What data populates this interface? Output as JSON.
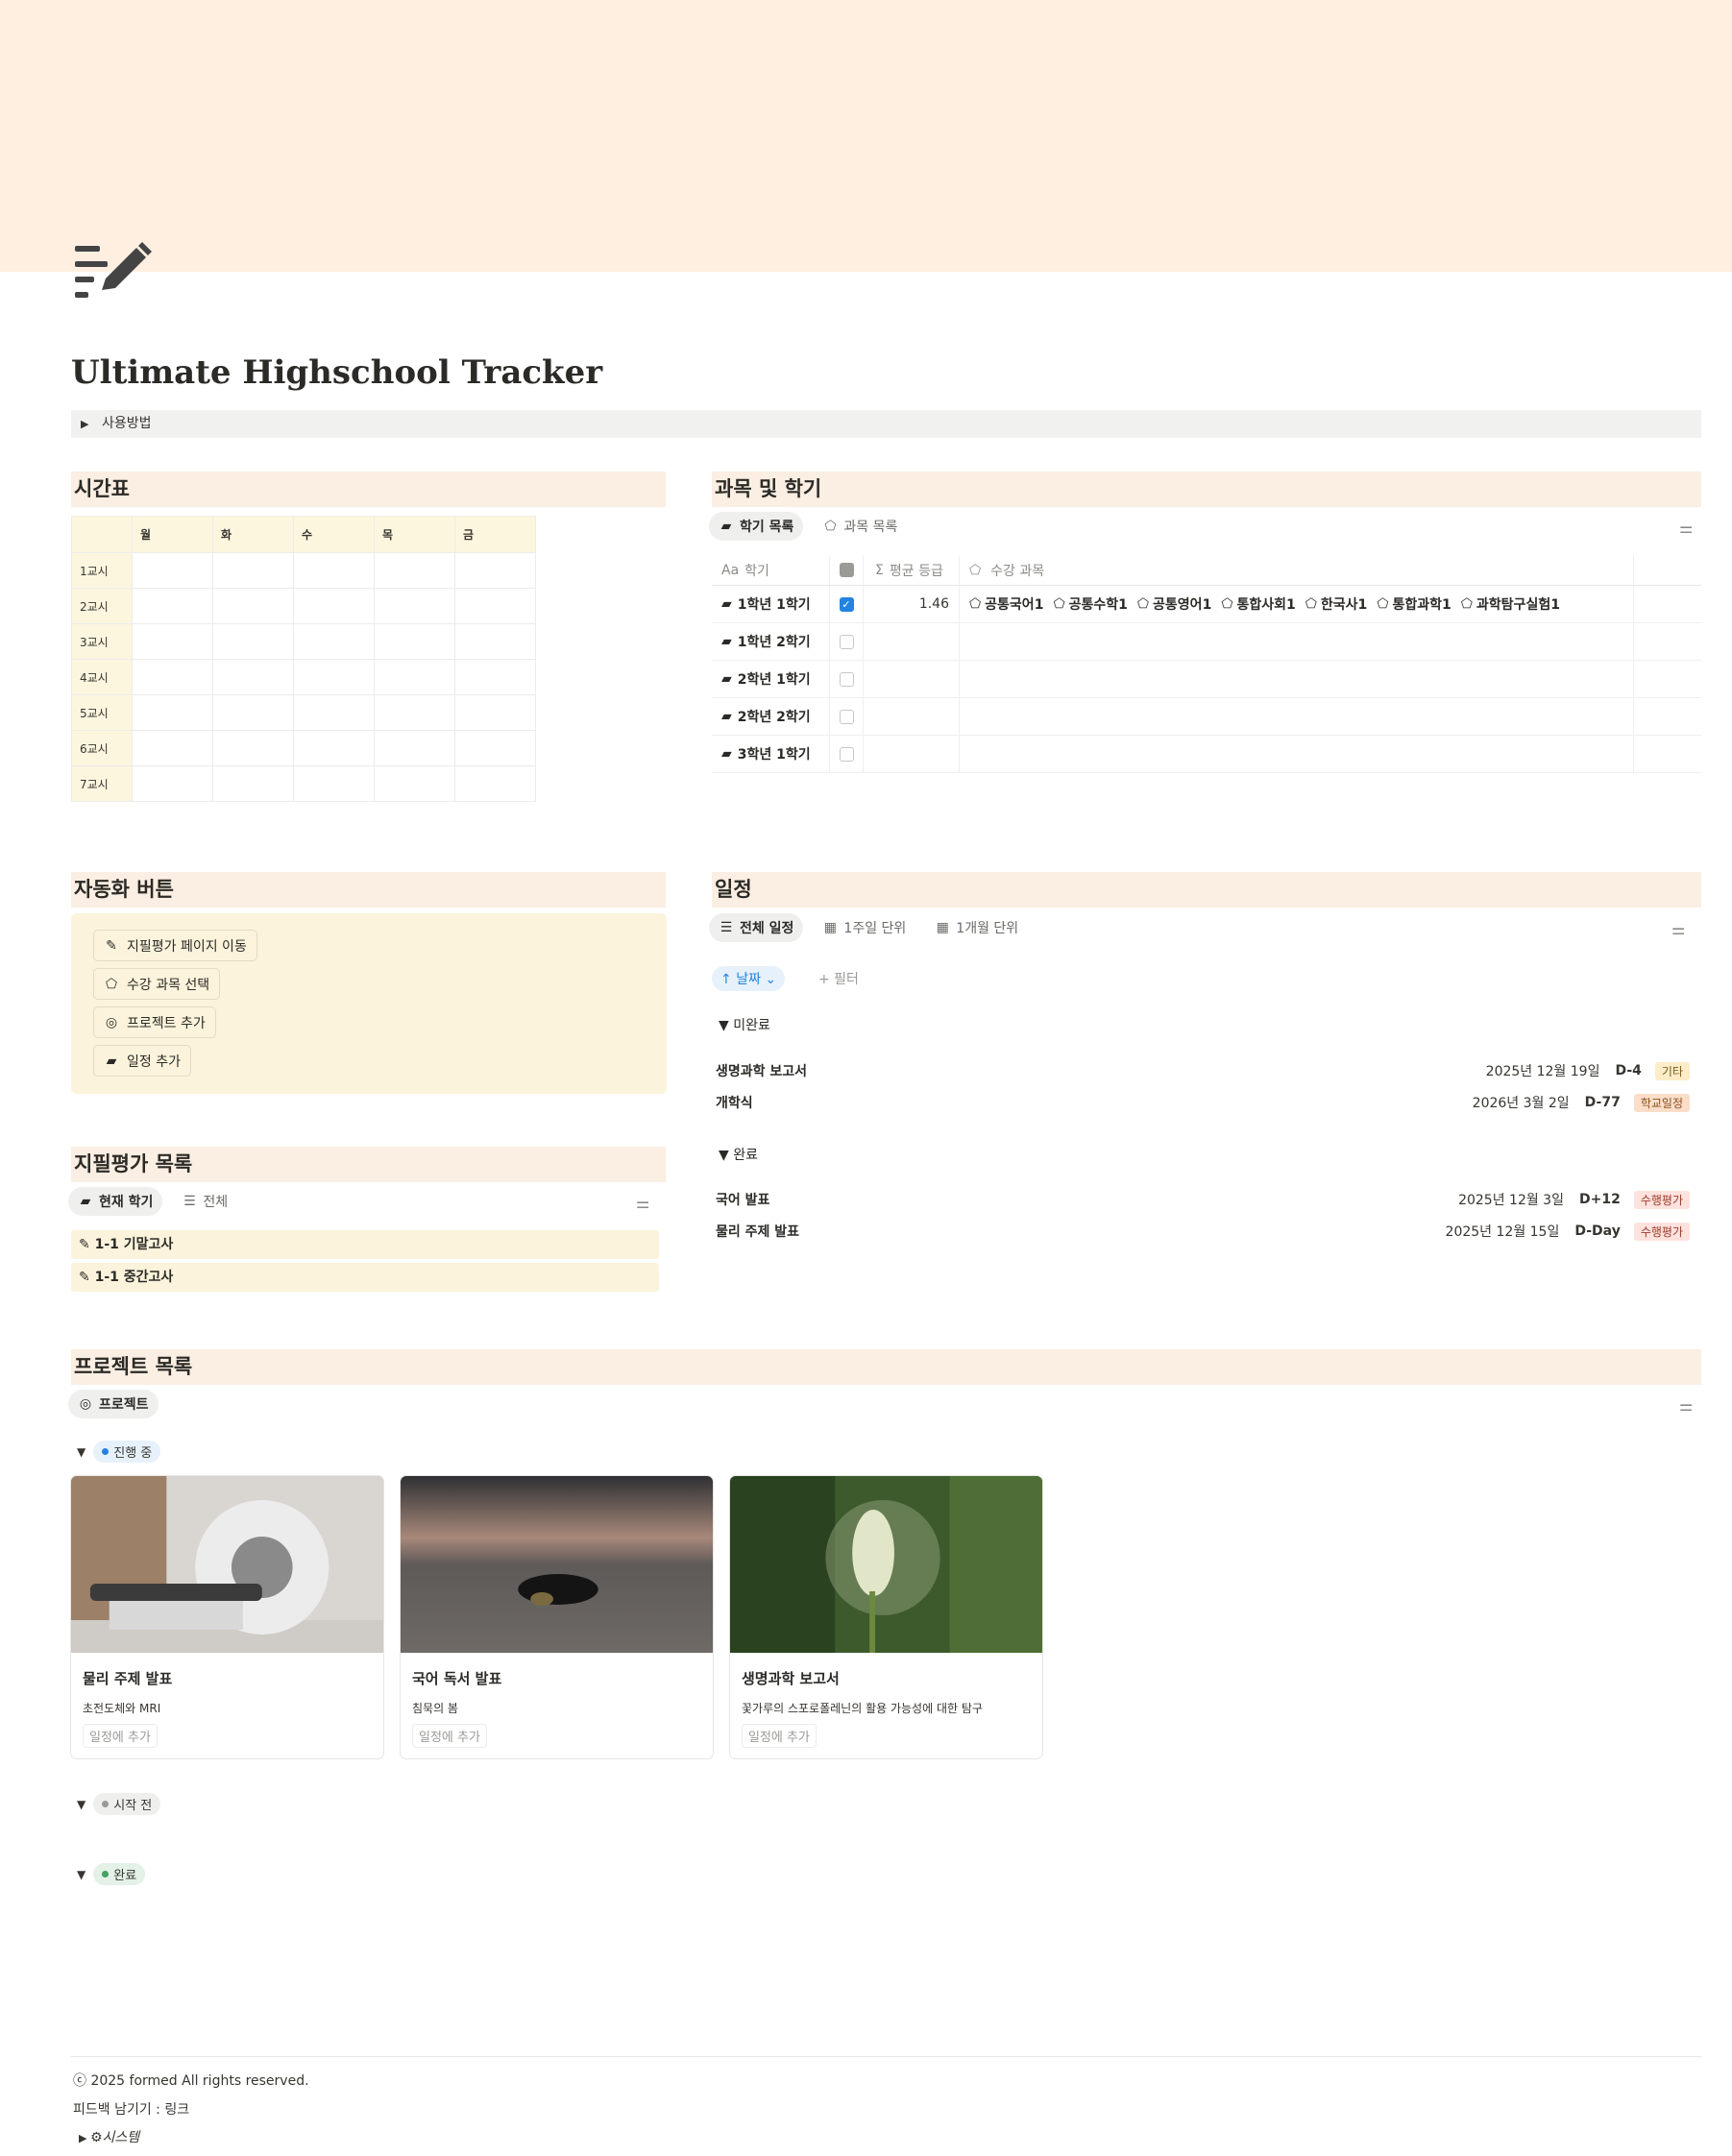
{
  "page": {
    "title": "Ultimate Highschool Tracker",
    "usage_toggle": "사용방법",
    "cover_color": "#ffefe1",
    "page_icon": "notes-pen-icon"
  },
  "timetable": {
    "heading": "시간표",
    "days": [
      "월",
      "화",
      "수",
      "목",
      "금"
    ],
    "periods": [
      "1교시",
      "2교시",
      "3교시",
      "4교시",
      "5교시",
      "6교시",
      "7교시"
    ]
  },
  "subjects": {
    "heading": "과목 및 학기",
    "tabs": [
      "학기 목록",
      "과목 목록"
    ],
    "columns": [
      "학기",
      "평균 등급",
      "수강 과목"
    ],
    "rows": [
      {
        "name": "1학년 1학기",
        "checked": true,
        "avg": "1.46",
        "subjects": [
          "공통국어1",
          "공통수학1",
          "공통영어1",
          "통합사회1",
          "한국사1",
          "통합과학1",
          "과학탐구실험1"
        ]
      },
      {
        "name": "1학년 2학기",
        "checked": false,
        "avg": "",
        "subjects": []
      },
      {
        "name": "2학년 1학기",
        "checked": false,
        "avg": "",
        "subjects": []
      },
      {
        "name": "2학년 2학기",
        "checked": false,
        "avg": "",
        "subjects": []
      },
      {
        "name": "3학년 1학기",
        "checked": false,
        "avg": "",
        "subjects": []
      }
    ]
  },
  "automation": {
    "heading": "자동화 버튼",
    "buttons": [
      "지필평가 페이지 이동",
      "수강 과목 선택",
      "프로젝트 추가",
      "일정 추가"
    ]
  },
  "exams": {
    "heading": "지필평가 목록",
    "tabs": [
      "현재 학기",
      "전체"
    ],
    "items": [
      "1-1 기말고사",
      "1-1 중간고사"
    ]
  },
  "schedule": {
    "heading": "일정",
    "tabs": [
      "전체 일정",
      "1주일 단위",
      "1개월 단위"
    ],
    "sort_label": "날짜",
    "filter_label": "+ 필터",
    "groups": [
      {
        "name": "미완료",
        "items": [
          {
            "name": "생명과학 보고서",
            "date": "2025년 12월 19일",
            "dday": "D-4",
            "tag": "기타",
            "tag_bg": "#fdecc8",
            "tag_fg": "#7a5a1a"
          },
          {
            "name": "개학식",
            "date": "2026년 3월 2일",
            "dday": "D-77",
            "tag": "학교일정",
            "tag_bg": "#fadec9",
            "tag_fg": "#8a4f1f"
          }
        ]
      },
      {
        "name": "완료",
        "items": [
          {
            "name": "국어 발표",
            "date": "2025년 12월 3일",
            "dday": "D+12",
            "tag": "수행평가",
            "tag_bg": "#ffe2dd",
            "tag_fg": "#9a3a2a"
          },
          {
            "name": "물리 주제 발표",
            "date": "2025년 12월 15일",
            "dday": "D-Day",
            "tag": "수행평가",
            "tag_bg": "#ffe2dd",
            "tag_fg": "#9a3a2a"
          }
        ]
      }
    ]
  },
  "projects": {
    "heading": "프로젝트 목록",
    "tab": "프로젝트",
    "statuses": [
      {
        "name": "진행 중",
        "bg": "#e7f1fb",
        "dot": "#2383e2"
      },
      {
        "name": "시작 전",
        "bg": "#efefed",
        "dot": "#9b9a97"
      },
      {
        "name": "완료",
        "bg": "#e3f1e7",
        "dot": "#44a063"
      }
    ],
    "cards": [
      {
        "title": "물리 주제 발표",
        "sub": "초전도체와 MRI",
        "button": "일정에 추가"
      },
      {
        "title": "국어 독서 발표",
        "sub": "침묵의 봄",
        "button": "일정에 추가"
      },
      {
        "title": "생명과학 보고서",
        "sub": "꽃가루의 스포로폴레닌의 활용 가능성에 대한 탐구",
        "button": "일정에 추가"
      }
    ]
  },
  "footer": {
    "copyright": "ⓒ 2025 formed All rights reserved.",
    "feedback": "피드백 남기기 : 링크",
    "system": "시스템"
  }
}
